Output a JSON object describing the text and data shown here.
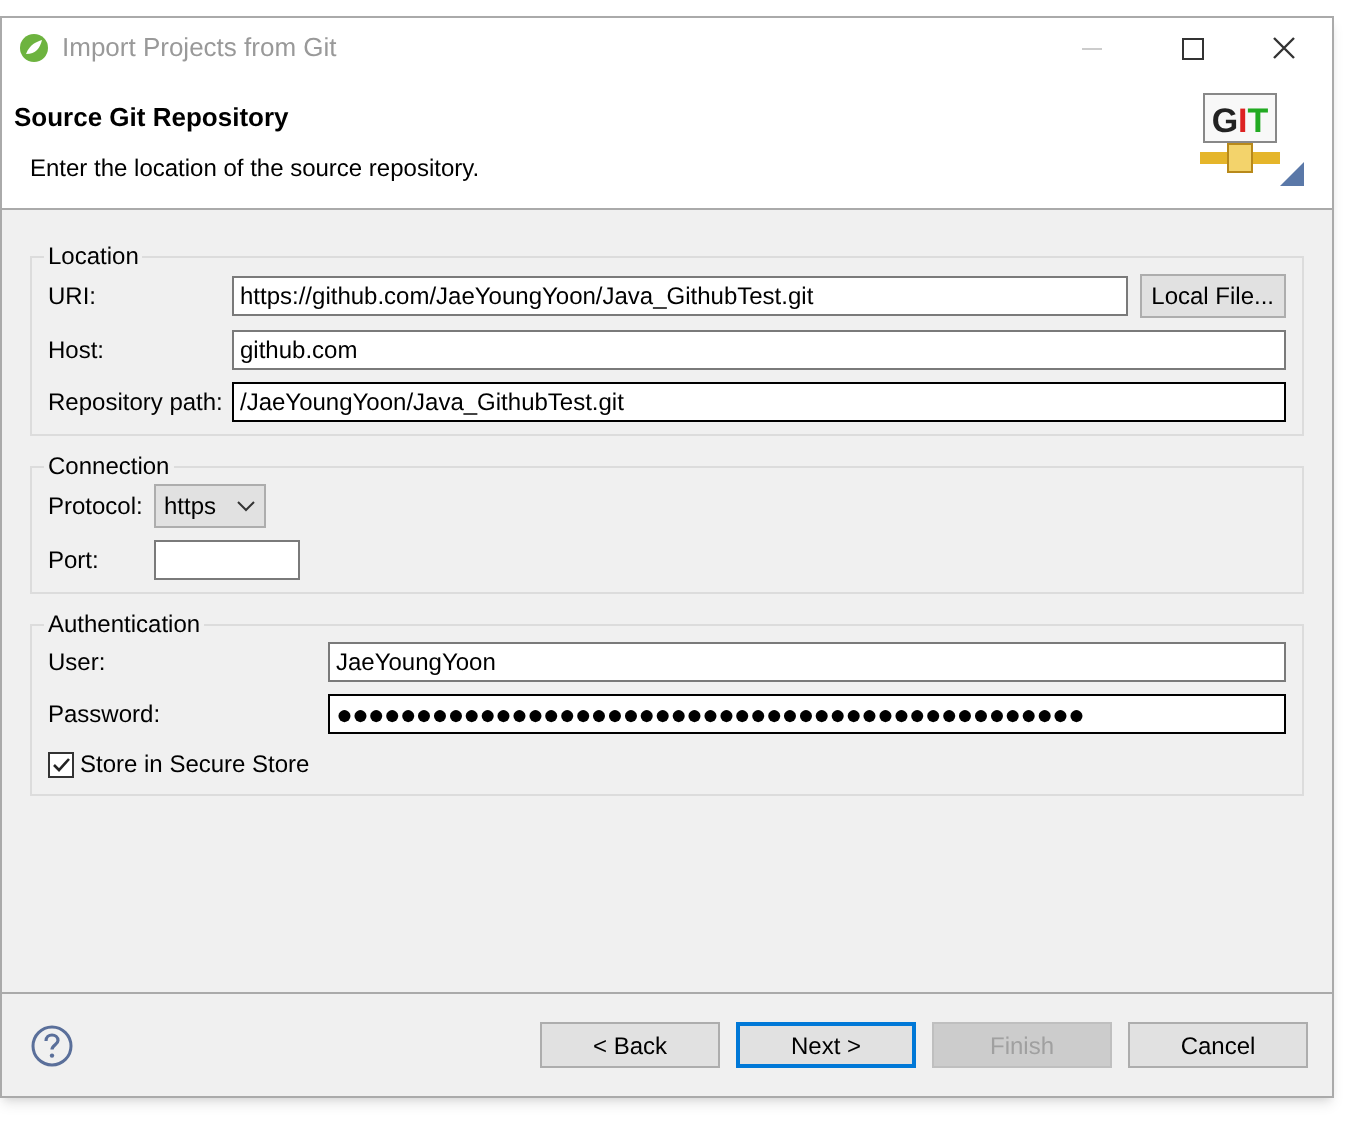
{
  "window": {
    "title": "Import Projects from Git"
  },
  "header": {
    "title": "Source Git Repository",
    "description": "Enter the location of the source repository.",
    "logo_text": "GIT"
  },
  "location": {
    "legend": "Location",
    "fields": [
      {
        "label": "URI:",
        "value": "https://github.com/JaeYoungYoon/Java_GithubTest.git",
        "button": "Local File...",
        "focused": false
      },
      {
        "label": "Host:",
        "value": "github.com",
        "focused": false
      },
      {
        "label": "Repository path:",
        "value": "/JaeYoungYoon/Java_GithubTest.git",
        "focused": true
      }
    ]
  },
  "connection": {
    "legend": "Connection",
    "protocol_label": "Protocol:",
    "protocol": "https",
    "port_label": "Port:"
  },
  "authentication": {
    "legend": "Authentication",
    "user_label": "User:",
    "user": "JaeYoungYoon",
    "password_label": "Password:",
    "password": "●●●●●●●●●●●●●●●●●●●●●●●●●●●●●●●●●●●●●●●●●●●●●●●",
    "store_label": "Store in Secure Store",
    "store_checked": true
  },
  "buttons": [
    {
      "label": "< Back",
      "disabled": false,
      "default": false
    },
    {
      "label": "Next >",
      "disabled": false,
      "default": true
    },
    {
      "label": "Finish",
      "disabled": true,
      "default": false
    },
    {
      "label": "Cancel",
      "disabled": false,
      "default": false
    }
  ]
}
